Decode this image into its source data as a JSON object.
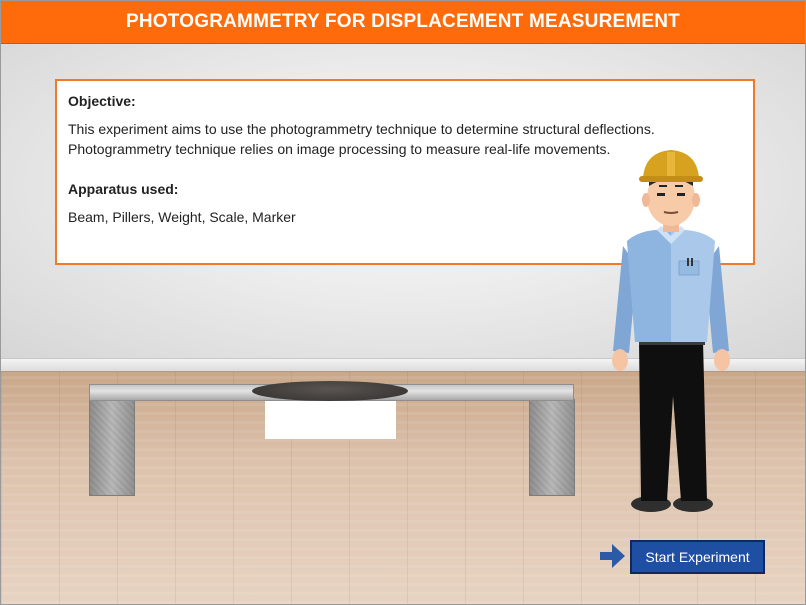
{
  "header": {
    "title": "PHOTOGRAMMETRY FOR DISPLACEMENT MEASUREMENT"
  },
  "panel": {
    "objective_heading": "Objective:",
    "objective_line1": "This experiment aims to use the photogrammetry technique to determine structural deflections.",
    "objective_line2": "Photogrammetry technique relies on image processing to measure real-life movements.",
    "apparatus_heading": "Apparatus used:",
    "apparatus_list": "Beam, Pillers, Weight, Scale, Marker"
  },
  "actions": {
    "start_label": "Start Experiment"
  },
  "icons": {
    "start_arrow": "arrow-right-icon"
  },
  "colors": {
    "header_bg": "#ff6a0a",
    "panel_border": "#f07a25",
    "button_bg": "#1f4fa3",
    "arrow": "#2d5aa6"
  }
}
